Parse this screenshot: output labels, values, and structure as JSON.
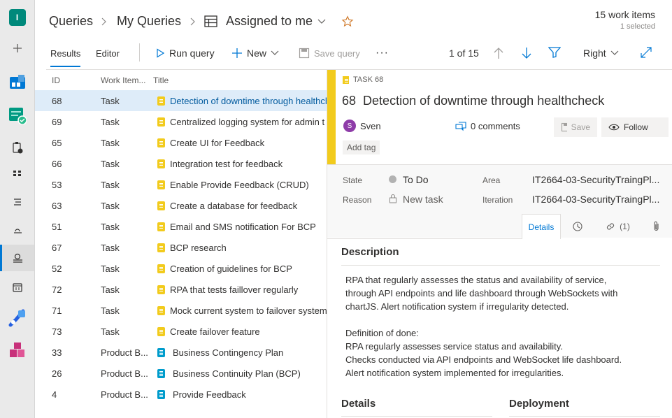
{
  "rail": {
    "org_initial": "I",
    "items": [
      "plus-icon",
      "boards-icon",
      "overview-icon",
      "tasks-icon",
      "backlog-icon",
      "sprints-icon",
      "queries-icon",
      "queries-active-icon",
      "calendar-icon",
      "pipelines-icon",
      "artifacts-icon"
    ]
  },
  "breadcrumb": {
    "root": "Queries",
    "folder": "My Queries",
    "query": "Assigned to me"
  },
  "summary": {
    "count": "15 work items",
    "selected": "1 selected"
  },
  "toolbar": {
    "results": "Results",
    "editor": "Editor",
    "run_query": "Run query",
    "new": "New",
    "save_query": "Save query",
    "more": "···",
    "pager": "1 of 15",
    "pane": "Right"
  },
  "grid": {
    "columns": [
      "ID",
      "Work Item...",
      "Title"
    ],
    "rows": [
      {
        "id": "68",
        "type": "Task",
        "kind": "task",
        "title": "Detection of downtime through healthcheck"
      },
      {
        "id": "69",
        "type": "Task",
        "kind": "task",
        "title": "Centralized logging system for admin t"
      },
      {
        "id": "65",
        "type": "Task",
        "kind": "task",
        "title": "Create UI for Feedback"
      },
      {
        "id": "66",
        "type": "Task",
        "kind": "task",
        "title": "Integration test for feedback"
      },
      {
        "id": "53",
        "type": "Task",
        "kind": "task",
        "title": "Enable Provide Feedback (CRUD)"
      },
      {
        "id": "63",
        "type": "Task",
        "kind": "task",
        "title": "Create a database for feedback"
      },
      {
        "id": "51",
        "type": "Task",
        "kind": "task",
        "title": "Email and SMS notification For BCP"
      },
      {
        "id": "67",
        "type": "Task",
        "kind": "task",
        "title": "BCP research"
      },
      {
        "id": "52",
        "type": "Task",
        "kind": "task",
        "title": "Creation of guidelines for BCP"
      },
      {
        "id": "72",
        "type": "Task",
        "kind": "task",
        "title": "RPA that tests faillover regularly"
      },
      {
        "id": "71",
        "type": "Task",
        "kind": "task",
        "title": "Mock current system to failover system"
      },
      {
        "id": "73",
        "type": "Task",
        "kind": "task",
        "title": "Create failover feature"
      },
      {
        "id": "33",
        "type": "Product B...",
        "kind": "pbi",
        "title": "Business Contingency Plan"
      },
      {
        "id": "26",
        "type": "Product B...",
        "kind": "pbi",
        "title": "Business Continuity Plan (BCP)"
      },
      {
        "id": "4",
        "type": "Product B...",
        "kind": "pbi",
        "title": "Provide Feedback"
      }
    ]
  },
  "detail": {
    "type_label": "TASK 68",
    "id": "68",
    "title": "Detection of downtime through healthcheck",
    "assignee_initial": "S",
    "assignee": "Sven",
    "comments": "0 comments",
    "save": "Save",
    "follow": "Follow",
    "add_tag": "Add tag",
    "state_label": "State",
    "state_value": "To Do",
    "reason_label": "Reason",
    "reason_value": "New task",
    "area_label": "Area",
    "area_value": "IT2664-03-SecurityTraingPl...",
    "iteration_label": "Iteration",
    "iteration_value": "IT2664-03-SecurityTraingPl...",
    "tabs": {
      "details": "Details",
      "links": "(1)"
    },
    "description_heading": "Description",
    "description": [
      "RPA that regularly assesses the status and availability of service,",
      "through API endpoints and life dashboard through WebSockets with",
      "chartJS. Alert notification system if irregularity detected.",
      "",
      "Definition of done:",
      "RPA regularly assesses service status and availability.",
      "Checks conducted via API endpoints and WebSocket life dashboard.",
      "Alert notification system implemented for irregularities."
    ],
    "details_heading": "Details",
    "deployment_heading": "Deployment"
  },
  "colors": {
    "accent": "#0078d4",
    "task": "#f2cb1d",
    "pbi": "#009ccc",
    "selected_row": "#deecf9",
    "avatar": "#8e3ca8"
  }
}
